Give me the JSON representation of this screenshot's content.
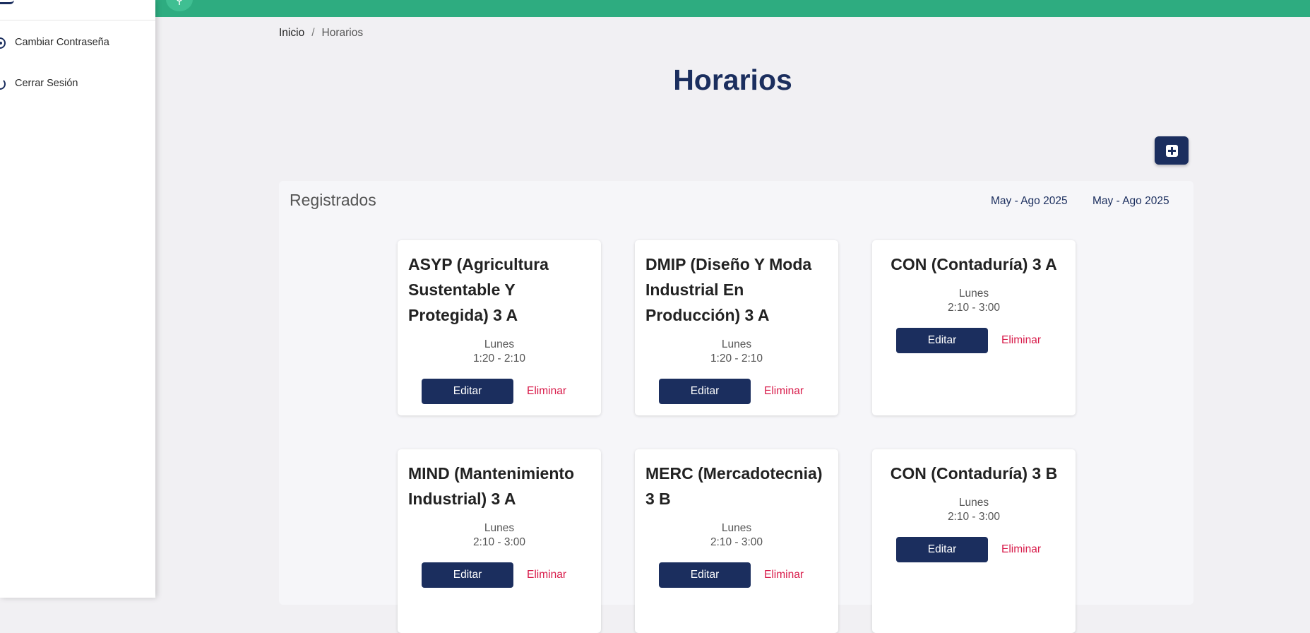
{
  "sidebar": {
    "items": [
      {
        "label": "Cambiar Contraseña",
        "icon": "key-circle-icon"
      },
      {
        "label": "Cerrar Sesión",
        "icon": "power-icon"
      }
    ]
  },
  "topbar": {
    "color": "#2eac80",
    "menu_icon": "search-icon"
  },
  "breadcrumb": {
    "home": "Inicio",
    "separator": "/",
    "current": "Horarios"
  },
  "page": {
    "title": "Horarios",
    "add_icon": "plus-square-icon"
  },
  "panel": {
    "title": "Registrados",
    "periods": [
      "May - Ago 2025",
      "May - Ago 2025"
    ]
  },
  "cards": [
    {
      "title": "ASYP (Agricultura Sustentable Y Protegida) 3 A",
      "day": "Lunes",
      "time": "1:20 - 2:10",
      "edit": "Editar",
      "delete": "Eliminar"
    },
    {
      "title": "DMIP (Diseño Y Moda Industrial En Producción) 3 A",
      "day": "Lunes",
      "time": "1:20 - 2:10",
      "edit": "Editar",
      "delete": "Eliminar"
    },
    {
      "title": "CON (Contaduría) 3 A",
      "day": "Lunes",
      "time": "2:10 - 3:00",
      "edit": "Editar",
      "delete": "Eliminar"
    },
    {
      "title": "MIND (Mantenimiento Industrial) 3 A",
      "day": "Lunes",
      "time": "2:10 - 3:00",
      "edit": "Editar",
      "delete": "Eliminar"
    },
    {
      "title": "MERC (Mercadotecnia) 3 B",
      "day": "Lunes",
      "time": "2:10 - 3:00",
      "edit": "Editar",
      "delete": "Eliminar"
    },
    {
      "title": "CON (Contaduría) 3 B",
      "day": "Lunes",
      "time": "2:10 - 3:00",
      "edit": "Editar",
      "delete": "Eliminar"
    }
  ],
  "colors": {
    "primary": "#1b2e5e",
    "accent": "#2eac80",
    "danger": "#d81b4a"
  }
}
